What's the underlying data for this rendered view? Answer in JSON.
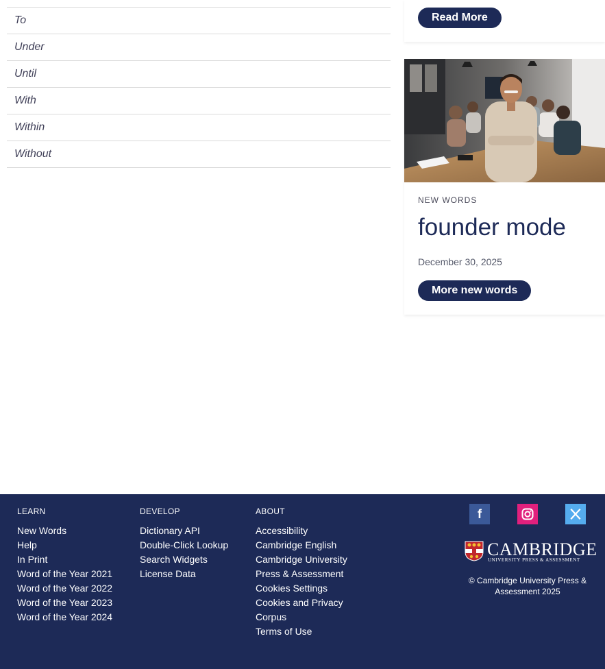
{
  "word_list": [
    "To",
    "Under",
    "Until",
    "With",
    "Within",
    "Without"
  ],
  "card_top": {
    "button_label": "Read More"
  },
  "card_new": {
    "kicker": "NEW WORDS",
    "headline": "founder mode",
    "date": "December 30, 2025",
    "button_label": "More new words"
  },
  "footer": {
    "learn": {
      "heading": "LEARN",
      "links": [
        "New Words",
        "Help",
        "In Print",
        "Word of the Year 2021",
        "Word of the Year 2022",
        "Word of the Year 2023",
        "Word of the Year 2024"
      ]
    },
    "develop": {
      "heading": "DEVELOP",
      "links": [
        "Dictionary API",
        "Double-Click Lookup",
        "Search Widgets",
        "License Data"
      ]
    },
    "about": {
      "heading": "ABOUT",
      "links": [
        "Accessibility",
        "Cambridge English",
        "Cambridge University",
        "Press & Assessment",
        "Cookies Settings",
        "Cookies and Privacy",
        "Corpus",
        "Terms of Use"
      ]
    },
    "social": {
      "facebook_glyph": "f",
      "x_glyph": "𝕏",
      "icons": [
        "facebook-icon",
        "instagram-icon",
        "x-icon"
      ],
      "colors": {
        "facebook": "#3b5998",
        "instagram": "#e1207d",
        "x": "#55acee"
      }
    },
    "logo": {
      "word": "CAMBRIDGE",
      "sub": "UNIVERSITY PRESS & ASSESSMENT"
    },
    "copyright": "© Cambridge University Press & Assessment 2025"
  },
  "colors": {
    "navy": "#1d2a57",
    "divider": "#d9d9d9"
  }
}
